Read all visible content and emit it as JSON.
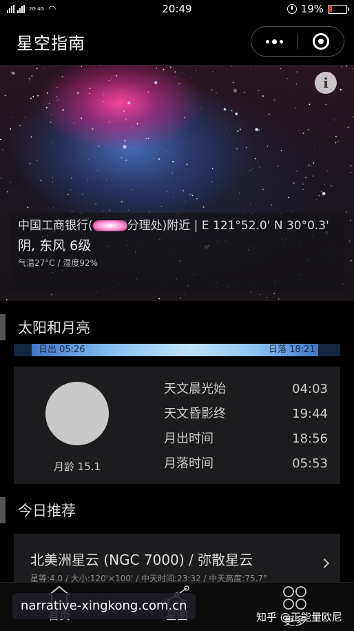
{
  "status_bar": {
    "network": "2G 4G",
    "time": "20:49",
    "battery": "19%",
    "battery_level": 0.19
  },
  "header": {
    "title": "星空指南"
  },
  "hero": {
    "location": "中国工商银行(",
    "location_after": "分理处)附近 | E 121°52.0' N 30°0.3'",
    "weather": "阴, 东风 6级",
    "temp_humidity": "气温27°C / 湿度92%"
  },
  "sun_moon": {
    "section_title": "太阳和月亮",
    "sunrise": "日出 05:26",
    "sunset": "日落 18:21",
    "moon_age": "月龄 15.1",
    "times": [
      {
        "label": "天文晨光始",
        "value": "04:03"
      },
      {
        "label": "天文昏影终",
        "value": "19:44"
      },
      {
        "label": "月出时间",
        "value": "18:56"
      },
      {
        "label": "月落时间",
        "value": "05:53"
      }
    ]
  },
  "recommend": {
    "section_title": "今日推荐",
    "title": "北美洲星云 (NGC 7000) / 弥散星云",
    "subtitle": "星等:4.0 / 大小:120'×100' / 中天时间:23:32 / 中天高度:75.7°"
  },
  "nav": {
    "items": [
      {
        "label": "首页"
      },
      {
        "label": "星图"
      },
      {
        "label": "更多"
      }
    ]
  },
  "watermark": {
    "site": "narrative-xingkong.com.cn",
    "zhihu": "知乎 @正能量欧尼"
  },
  "colors": {
    "background": "#000000",
    "card": "#1c1c1e",
    "battery_low": "#e53935",
    "sun_bar": "#8ac4f4"
  }
}
